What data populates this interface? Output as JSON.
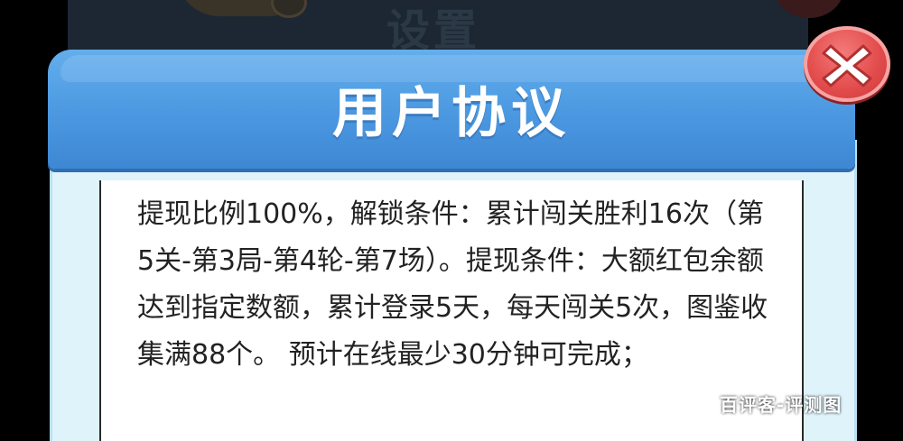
{
  "background": {
    "title": "设置"
  },
  "dialog": {
    "title": "用户协议",
    "content": "提现比例100%，解锁条件：累计闯关胜利16次（第5关-第3局-第4轮-第7场）。提现条件：大额红包余额达到指定数额，累计登录5天，每天闯关5次，图鉴收集满88个。 预计在线最少30分钟可完成；",
    "close_icon": "close-x-icon"
  },
  "watermark": {
    "text": "百评客-评测图"
  },
  "colors": {
    "header_blue": "#4b98e1",
    "body_light_blue": "#dff3fb",
    "close_red": "#e24b4b",
    "text_dark": "#222222"
  }
}
